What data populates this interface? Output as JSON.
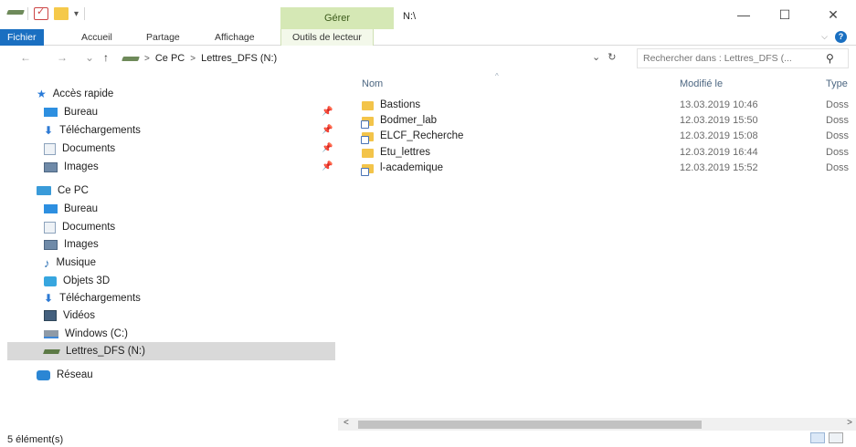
{
  "window": {
    "title": "N:\\",
    "contextual_tab_header": "Gérer",
    "controls": {
      "minimize": "—",
      "maximize": "☐",
      "close": "✕"
    }
  },
  "ribbon": {
    "tabs": [
      "Fichier",
      "Accueil",
      "Partage",
      "Affichage",
      "Outils de lecteur"
    ],
    "active_tab": "Fichier",
    "collapse_glyph": "⌵",
    "help_glyph": "?"
  },
  "address": {
    "nav": {
      "back": "←",
      "forward": "→",
      "recent": "⌄",
      "up": "↑"
    },
    "breadcrumb": [
      "Ce PC",
      "Lettres_DFS (N:)"
    ],
    "dropdown_glyph": "⌄",
    "refresh_glyph": "↻",
    "search_placeholder": "Rechercher dans : Lettres_DFS (...",
    "search_glyph": "⚲"
  },
  "sidebar": {
    "quick_access": {
      "label": "Accès rapide",
      "items": [
        {
          "label": "Bureau",
          "icon": "desktop-icon",
          "pinned": true
        },
        {
          "label": "Téléchargements",
          "icon": "download-icon",
          "pinned": true
        },
        {
          "label": "Documents",
          "icon": "documents-icon",
          "pinned": true
        },
        {
          "label": "Images",
          "icon": "pictures-icon",
          "pinned": true
        }
      ]
    },
    "this_pc": {
      "label": "Ce PC",
      "items": [
        {
          "label": "Bureau",
          "icon": "desktop-icon"
        },
        {
          "label": "Documents",
          "icon": "documents-icon"
        },
        {
          "label": "Images",
          "icon": "pictures-icon"
        },
        {
          "label": "Musique",
          "icon": "music-icon"
        },
        {
          "label": "Objets 3D",
          "icon": "3d-objects-icon"
        },
        {
          "label": "Téléchargements",
          "icon": "download-icon"
        },
        {
          "label": "Vidéos",
          "icon": "videos-icon"
        },
        {
          "label": "Windows (C:)",
          "icon": "windows-drive-icon"
        },
        {
          "label": "Lettres_DFS (N:)",
          "icon": "network-drive-icon",
          "selected": true
        }
      ]
    },
    "network": {
      "label": "Réseau",
      "icon": "network-icon"
    },
    "pin_glyph": "📌"
  },
  "content": {
    "columns": [
      "Nom",
      "Modifié le",
      "Type"
    ],
    "sort_glyph": "^",
    "rows": [
      {
        "name": "Bastions",
        "date": "13.03.2019 10:46",
        "type": "Doss",
        "shortcut": false
      },
      {
        "name": "Bodmer_lab",
        "date": "12.03.2019 15:50",
        "type": "Doss",
        "shortcut": true
      },
      {
        "name": "ELCF_Recherche",
        "date": "12.03.2019 15:08",
        "type": "Doss",
        "shortcut": true
      },
      {
        "name": "Etu_lettres",
        "date": "12.03.2019 16:44",
        "type": "Doss",
        "shortcut": false
      },
      {
        "name": "l-academique",
        "date": "12.03.2019 15:52",
        "type": "Doss",
        "shortcut": true
      }
    ]
  },
  "scrollbar": {
    "left": "<",
    "right": ">"
  },
  "status": {
    "count_text": "5 élément(s)"
  }
}
